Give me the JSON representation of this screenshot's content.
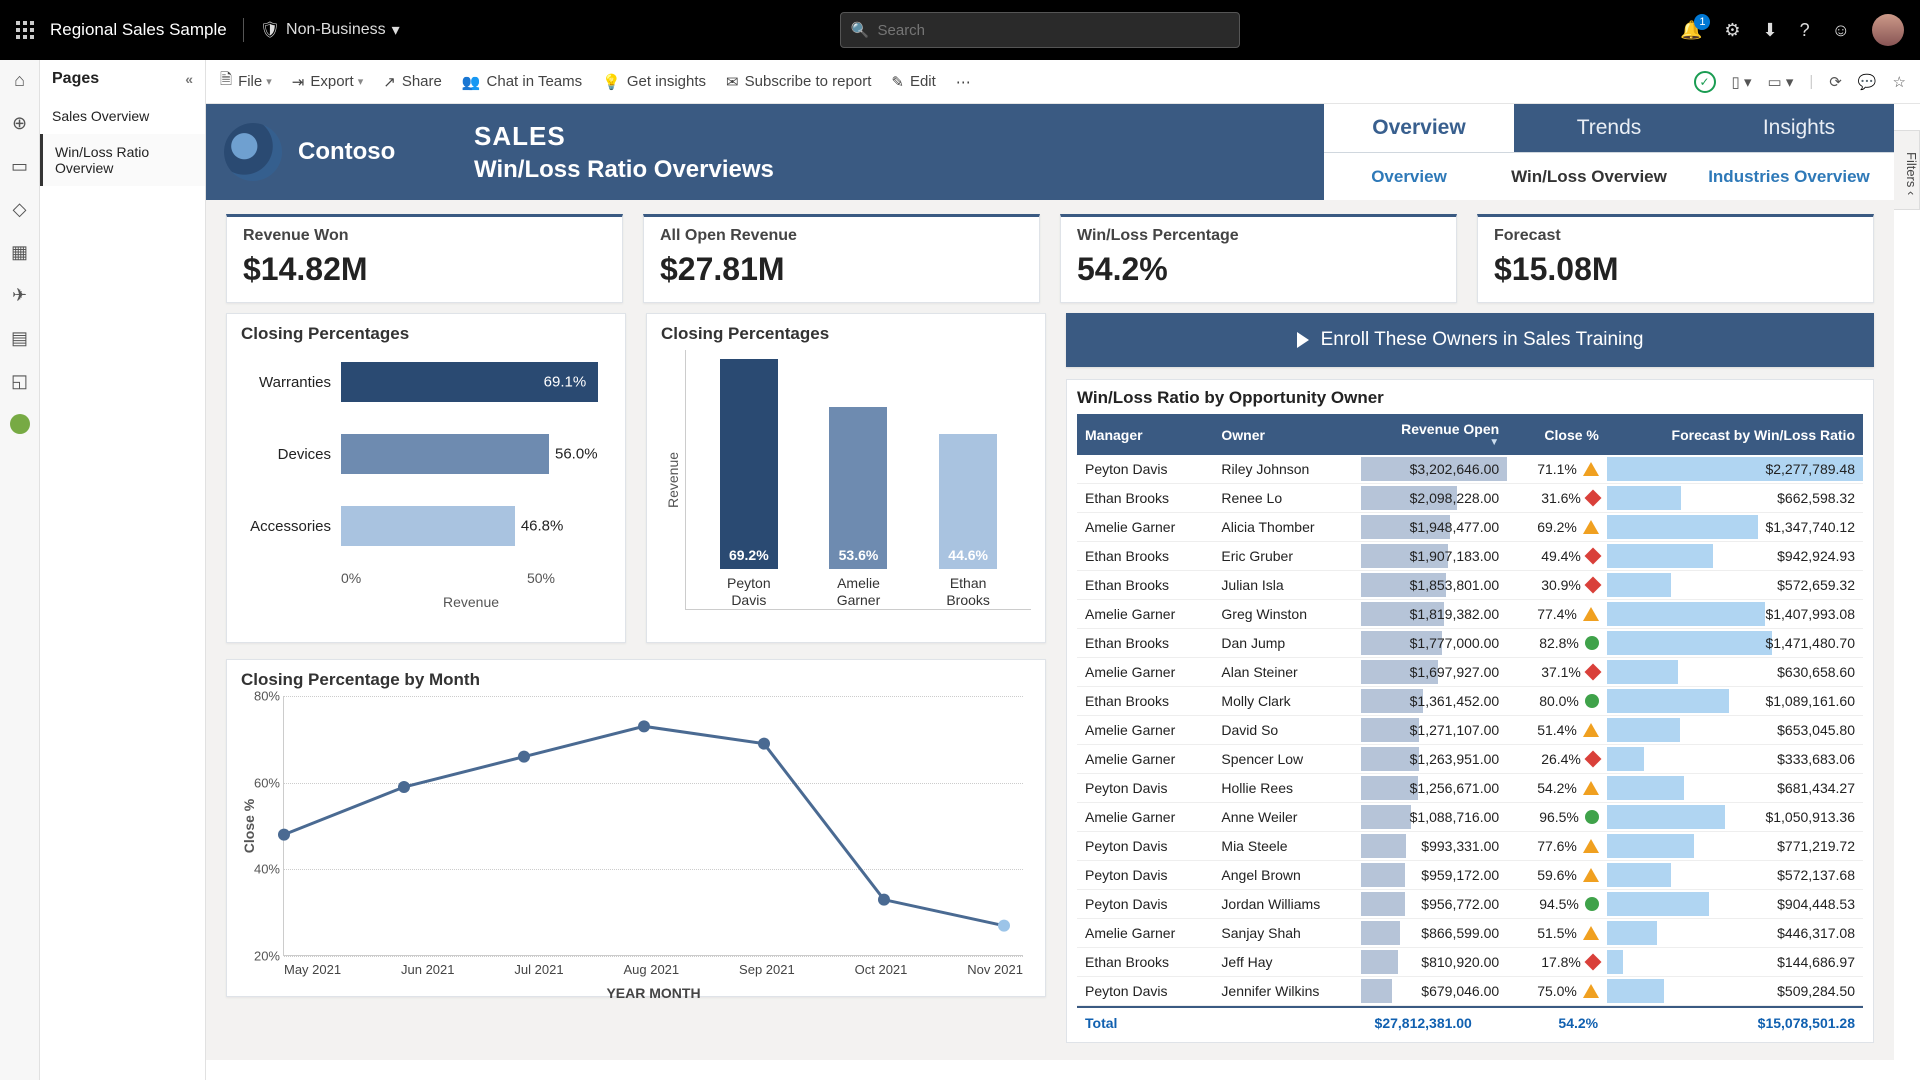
{
  "app": {
    "title": "Regional Sales Sample",
    "sensitivity": "Non-Business",
    "search_placeholder": "Search",
    "notification_count": "1"
  },
  "pages": {
    "header": "Pages",
    "items": [
      "Sales Overview",
      "Win/Loss Ratio Overview"
    ],
    "active_index": 1
  },
  "toolbar": {
    "file": "File",
    "export": "Export",
    "share": "Share",
    "chat": "Chat in Teams",
    "insights": "Get insights",
    "subscribe": "Subscribe to report",
    "edit": "Edit"
  },
  "filters_label": "Filters",
  "header": {
    "brand": "Contoso",
    "section": "SALES",
    "subtitle": "Win/Loss Ratio Overviews",
    "tabs1": [
      "Overview",
      "Trends",
      "Insights"
    ],
    "tabs1_active": 0,
    "tabs2": [
      "Overview",
      "Win/Loss Overview",
      "Industries Overview"
    ],
    "tabs2_active": 1
  },
  "kpi": [
    {
      "label": "Revenue Won",
      "value": "$14.82M"
    },
    {
      "label": "All Open Revenue",
      "value": "$27.81M"
    },
    {
      "label": "Win/Loss Percentage",
      "value": "54.2%"
    },
    {
      "label": "Forecast",
      "value": "$15.08M"
    }
  ],
  "enroll_button": "Enroll These Owners in Sales Training",
  "charts": {
    "hbar_title": "Closing Percentages",
    "vbar_title": "Closing Percentages",
    "line_title": "Closing Percentage by Month"
  },
  "chart_data": [
    {
      "id": "hbar",
      "type": "bar",
      "orientation": "horizontal",
      "title": "Closing Percentages",
      "xlabel": "Revenue",
      "categories": [
        "Warranties",
        "Devices",
        "Accessories"
      ],
      "values": [
        69.1,
        56.0,
        46.8
      ],
      "value_labels": [
        "69.1%",
        "56.0%",
        "46.8%"
      ],
      "colors": [
        "#2a4a72",
        "#6e8bb0",
        "#a9c3e0"
      ],
      "xticks": [
        "0%",
        "50%"
      ],
      "xlim": [
        0,
        70
      ]
    },
    {
      "id": "vbar",
      "type": "bar",
      "orientation": "vertical",
      "title": "Closing Percentages",
      "ylabel": "Revenue",
      "categories": [
        "Peyton Davis",
        "Amelie Garner",
        "Ethan Brooks"
      ],
      "values": [
        69.2,
        53.6,
        44.6
      ],
      "value_labels": [
        "69.2%",
        "53.6%",
        "44.6%"
      ],
      "colors": [
        "#2a4a72",
        "#6e8bb0",
        "#a9c3e0"
      ]
    },
    {
      "id": "line",
      "type": "line",
      "title": "Closing Percentage by Month",
      "xlabel": "YEAR MONTH",
      "ylabel": "Close %",
      "x": [
        "May 2021",
        "Jun 2021",
        "Jul 2021",
        "Aug 2021",
        "Sep 2021",
        "Oct 2021",
        "Nov 2021"
      ],
      "y": [
        48,
        59,
        66,
        73,
        69,
        33,
        27
      ],
      "ylim": [
        20,
        80
      ],
      "yticks": [
        20,
        40,
        60,
        80
      ]
    }
  ],
  "table": {
    "title": "Win/Loss Ratio by Opportunity Owner",
    "columns": [
      "Manager",
      "Owner",
      "Revenue Open",
      "Close %",
      "Forecast by Win/Loss Ratio"
    ],
    "sort_col": 2,
    "max_rev": 3202646,
    "max_fc": 2277789.48,
    "rows": [
      {
        "m": "Peyton Davis",
        "o": "Riley Johnson",
        "rev": "$3,202,646.00",
        "rv": 3202646,
        "close": "71.1%",
        "ind": "yellow",
        "fc": "$2,277,789.48",
        "fv": 2277789.48
      },
      {
        "m": "Ethan Brooks",
        "o": "Renee Lo",
        "rev": "$2,098,228.00",
        "rv": 2098228,
        "close": "31.6%",
        "ind": "red",
        "fc": "$662,598.32",
        "fv": 662598.32
      },
      {
        "m": "Amelie Garner",
        "o": "Alicia Thomber",
        "rev": "$1,948,477.00",
        "rv": 1948477,
        "close": "69.2%",
        "ind": "yellow",
        "fc": "$1,347,740.12",
        "fv": 1347740.12
      },
      {
        "m": "Ethan Brooks",
        "o": "Eric Gruber",
        "rev": "$1,907,183.00",
        "rv": 1907183,
        "close": "49.4%",
        "ind": "red",
        "fc": "$942,924.93",
        "fv": 942924.93
      },
      {
        "m": "Ethan Brooks",
        "o": "Julian Isla",
        "rev": "$1,853,801.00",
        "rv": 1853801,
        "close": "30.9%",
        "ind": "red",
        "fc": "$572,659.32",
        "fv": 572659.32
      },
      {
        "m": "Amelie Garner",
        "o": "Greg Winston",
        "rev": "$1,819,382.00",
        "rv": 1819382,
        "close": "77.4%",
        "ind": "yellow",
        "fc": "$1,407,993.08",
        "fv": 1407993.08
      },
      {
        "m": "Ethan Brooks",
        "o": "Dan Jump",
        "rev": "$1,777,000.00",
        "rv": 1777000,
        "close": "82.8%",
        "ind": "green",
        "fc": "$1,471,480.70",
        "fv": 1471480.7
      },
      {
        "m": "Amelie Garner",
        "o": "Alan Steiner",
        "rev": "$1,697,927.00",
        "rv": 1697927,
        "close": "37.1%",
        "ind": "red",
        "fc": "$630,658.60",
        "fv": 630658.6
      },
      {
        "m": "Ethan Brooks",
        "o": "Molly Clark",
        "rev": "$1,361,452.00",
        "rv": 1361452,
        "close": "80.0%",
        "ind": "green",
        "fc": "$1,089,161.60",
        "fv": 1089161.6
      },
      {
        "m": "Amelie Garner",
        "o": "David So",
        "rev": "$1,271,107.00",
        "rv": 1271107,
        "close": "51.4%",
        "ind": "yellow",
        "fc": "$653,045.80",
        "fv": 653045.8
      },
      {
        "m": "Amelie Garner",
        "o": "Spencer Low",
        "rev": "$1,263,951.00",
        "rv": 1263951,
        "close": "26.4%",
        "ind": "red",
        "fc": "$333,683.06",
        "fv": 333683.06
      },
      {
        "m": "Peyton Davis",
        "o": "Hollie Rees",
        "rev": "$1,256,671.00",
        "rv": 1256671,
        "close": "54.2%",
        "ind": "yellow",
        "fc": "$681,434.27",
        "fv": 681434.27
      },
      {
        "m": "Amelie Garner",
        "o": "Anne Weiler",
        "rev": "$1,088,716.00",
        "rv": 1088716,
        "close": "96.5%",
        "ind": "green",
        "fc": "$1,050,913.36",
        "fv": 1050913.36
      },
      {
        "m": "Peyton Davis",
        "o": "Mia Steele",
        "rev": "$993,331.00",
        "rv": 993331,
        "close": "77.6%",
        "ind": "yellow",
        "fc": "$771,219.72",
        "fv": 771219.72
      },
      {
        "m": "Peyton Davis",
        "o": "Angel Brown",
        "rev": "$959,172.00",
        "rv": 959172,
        "close": "59.6%",
        "ind": "yellow",
        "fc": "$572,137.68",
        "fv": 572137.68
      },
      {
        "m": "Peyton Davis",
        "o": "Jordan Williams",
        "rev": "$956,772.00",
        "rv": 956772,
        "close": "94.5%",
        "ind": "green",
        "fc": "$904,448.53",
        "fv": 904448.53
      },
      {
        "m": "Amelie Garner",
        "o": "Sanjay Shah",
        "rev": "$866,599.00",
        "rv": 866599,
        "close": "51.5%",
        "ind": "yellow",
        "fc": "$446,317.08",
        "fv": 446317.08
      },
      {
        "m": "Ethan Brooks",
        "o": "Jeff Hay",
        "rev": "$810,920.00",
        "rv": 810920,
        "close": "17.8%",
        "ind": "red",
        "fc": "$144,686.97",
        "fv": 144686.97
      },
      {
        "m": "Peyton Davis",
        "o": "Jennifer Wilkins",
        "rev": "$679,046.00",
        "rv": 679046,
        "close": "75.0%",
        "ind": "yellow",
        "fc": "$509,284.50",
        "fv": 509284.5
      }
    ],
    "total": {
      "label": "Total",
      "rev": "$27,812,381.00",
      "close": "54.2%",
      "fc": "$15,078,501.28"
    }
  }
}
